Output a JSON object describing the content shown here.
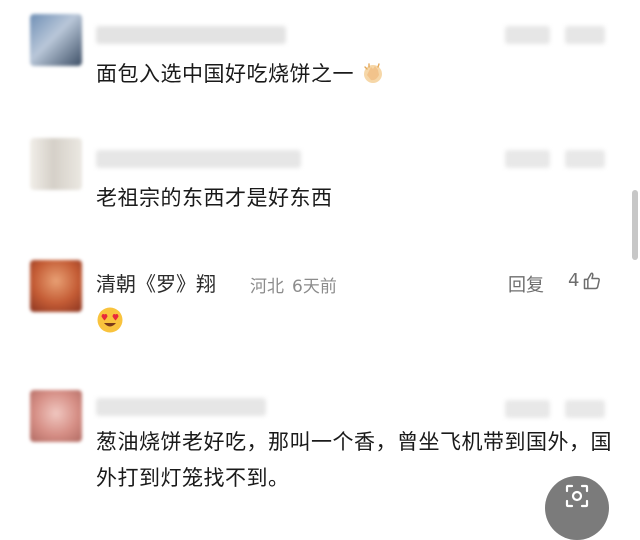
{
  "comments": [
    {
      "text": "面包入选中国好吃烧饼之一",
      "emoji": "clapping-hands-icon"
    },
    {
      "text": "老祖宗的东西才是好东西"
    },
    {
      "username": "清朝《罗》翔",
      "location": "河北",
      "time": "6天前",
      "reply_label": "回复",
      "like_count": "4",
      "emoji": "heart-eyes-icon"
    },
    {
      "text": "葱油烧饼老好吃，那叫一个香，曾坐飞机带到国外，国外打到灯笼找不到。"
    }
  ],
  "colors": {
    "text": "#1a1a1a",
    "meta": "#8c8c8c",
    "action": "#6d6d6d",
    "background": "#ffffff"
  }
}
